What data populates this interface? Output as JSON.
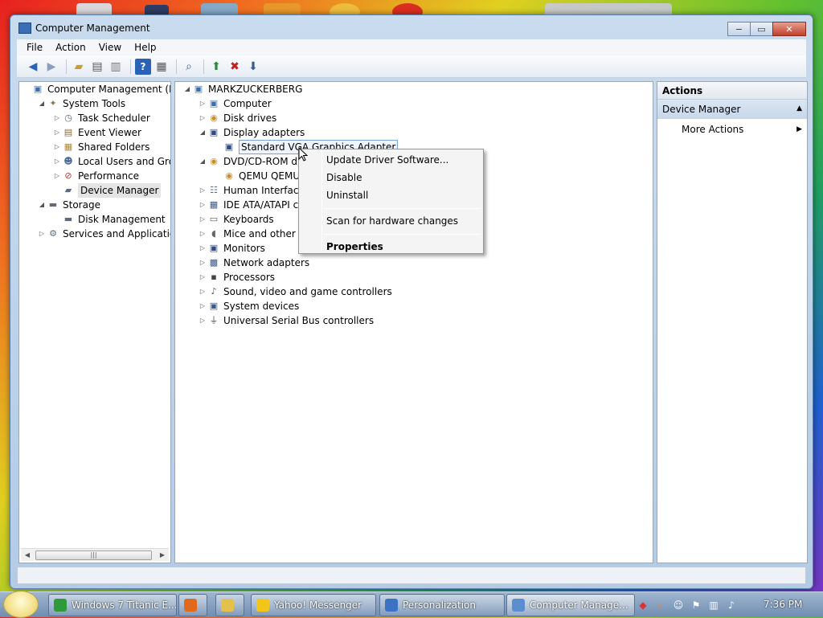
{
  "window": {
    "title": "Computer Management",
    "controls": {
      "minimize": "−",
      "maximize": "▭",
      "close": "✕"
    }
  },
  "menu": [
    "File",
    "Action",
    "View",
    "Help"
  ],
  "toolbar": {
    "buttons": [
      "back-icon",
      "forward-icon",
      "up-folder-icon",
      "show-hide-tree-icon",
      "export-list-icon",
      "help-icon",
      "action-pane-icon",
      "scan-hardware-icon",
      "update-driver-icon",
      "uninstall-icon",
      "disable-device-icon"
    ]
  },
  "left_tree": [
    {
      "label": "Computer Management (Local",
      "expander": "",
      "icon": "computer-management-icon",
      "level": 0
    },
    {
      "label": "System Tools",
      "expander": "◢",
      "icon": "system-tools-icon",
      "level": 1
    },
    {
      "label": "Task Scheduler",
      "expander": "▷",
      "icon": "task-scheduler-icon",
      "level": 2
    },
    {
      "label": "Event Viewer",
      "expander": "▷",
      "icon": "event-viewer-icon",
      "level": 2
    },
    {
      "label": "Shared Folders",
      "expander": "▷",
      "icon": "shared-folders-icon",
      "level": 2
    },
    {
      "label": "Local Users and Groups",
      "expander": "▷",
      "icon": "local-users-icon",
      "level": 2
    },
    {
      "label": "Performance",
      "expander": "▷",
      "icon": "performance-icon",
      "level": 2
    },
    {
      "label": "Device Manager",
      "expander": "",
      "icon": "device-manager-icon",
      "level": 2,
      "selected": true
    },
    {
      "label": "Storage",
      "expander": "◢",
      "icon": "storage-icon",
      "level": 1
    },
    {
      "label": "Disk Management",
      "expander": "",
      "icon": "disk-management-icon",
      "level": 2
    },
    {
      "label": "Services and Applications",
      "expander": "▷",
      "icon": "services-icon",
      "level": 1
    }
  ],
  "device_tree": [
    {
      "label": "MARKZUCKERBERG",
      "expander": "◢",
      "icon": "computer-icon",
      "level": 0
    },
    {
      "label": "Computer",
      "expander": "▷",
      "icon": "computer-icon",
      "level": 1
    },
    {
      "label": "Disk drives",
      "expander": "▷",
      "icon": "disk-drive-icon",
      "level": 1
    },
    {
      "label": "Display adapters",
      "expander": "◢",
      "icon": "display-adapter-icon",
      "level": 1
    },
    {
      "label": "Standard VGA Graphics Adapter",
      "expander": "",
      "icon": "display-adapter-icon",
      "level": 2,
      "selected": true
    },
    {
      "label": "DVD/CD-ROM dri",
      "expander": "◢",
      "icon": "dvd-drive-icon",
      "level": 1
    },
    {
      "label": "QEMU QEMU",
      "expander": "",
      "icon": "dvd-drive-icon",
      "level": 2
    },
    {
      "label": "Human Interface",
      "expander": "▷",
      "icon": "hid-icon",
      "level": 1
    },
    {
      "label": "IDE ATA/ATAPI c",
      "expander": "▷",
      "icon": "ide-controller-icon",
      "level": 1
    },
    {
      "label": "Keyboards",
      "expander": "▷",
      "icon": "keyboard-icon",
      "level": 1
    },
    {
      "label": "Mice and other p",
      "expander": "▷",
      "icon": "mouse-icon",
      "level": 1
    },
    {
      "label": "Monitors",
      "expander": "▷",
      "icon": "monitor-icon",
      "level": 1
    },
    {
      "label": "Network adapters",
      "expander": "▷",
      "icon": "network-adapter-icon",
      "level": 1
    },
    {
      "label": "Processors",
      "expander": "▷",
      "icon": "processor-icon",
      "level": 1
    },
    {
      "label": "Sound, video and game controllers",
      "expander": "▷",
      "icon": "sound-icon",
      "level": 1
    },
    {
      "label": "System devices",
      "expander": "▷",
      "icon": "system-devices-icon",
      "level": 1
    },
    {
      "label": "Universal Serial Bus controllers",
      "expander": "▷",
      "icon": "usb-icon",
      "level": 1
    }
  ],
  "context_menu": {
    "items": [
      {
        "label": "Update Driver Software...",
        "bold": false
      },
      {
        "label": "Disable",
        "bold": false
      },
      {
        "label": "Uninstall",
        "bold": false
      },
      {
        "separator": true
      },
      {
        "label": "Scan for hardware changes",
        "bold": false
      },
      {
        "separator": true
      },
      {
        "label": "Properties",
        "bold": true
      }
    ]
  },
  "actions": {
    "header": "Actions",
    "group": "Device Manager",
    "more": "More Actions"
  },
  "taskbar": {
    "buttons": [
      {
        "label": "Windows 7 Titanic E...",
        "icon": "chrome-icon",
        "color": "#2f9a3a"
      },
      {
        "label": "",
        "icon": "firefox-icon",
        "color": "#e06a1c"
      },
      {
        "label": "",
        "icon": "folder-icon",
        "color": "#e3c14a"
      },
      {
        "label": "Yahoo! Messenger",
        "icon": "yahoo-messenger-icon",
        "color": "#f2c51a"
      },
      {
        "label": "Personalization",
        "icon": "personalization-icon",
        "color": "#3b72c4"
      },
      {
        "label": "Computer Manage...",
        "icon": "computer-management-icon",
        "color": "#5b8ed0",
        "active": true
      }
    ],
    "tray_icons": [
      "antivirus-icon",
      "search-icon",
      "messenger-icon",
      "action-center-icon",
      "network-icon",
      "volume-icon"
    ],
    "clock": "7:36 PM"
  },
  "colors": {
    "accent": "#3a6fb5",
    "selection": "#7da2ce"
  }
}
